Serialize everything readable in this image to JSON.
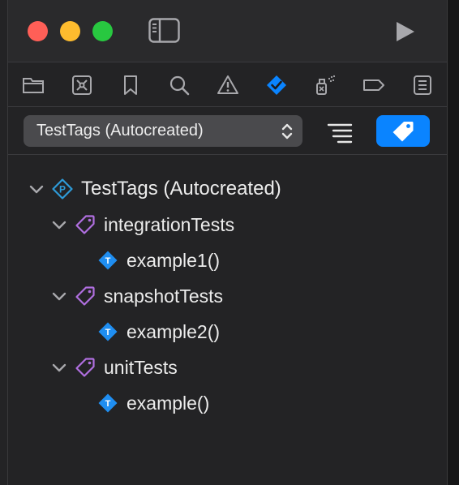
{
  "window": {
    "controls": [
      "close",
      "minimize",
      "zoom"
    ],
    "toolbar_icons": [
      "sidebar-toggle-icon",
      "play-icon"
    ]
  },
  "navigator_tabs": [
    {
      "name": "folder-icon",
      "selected": false
    },
    {
      "name": "source-control-icon",
      "selected": false
    },
    {
      "name": "bookmark-icon",
      "selected": false
    },
    {
      "name": "search-icon",
      "selected": false
    },
    {
      "name": "warning-icon",
      "selected": false
    },
    {
      "name": "test-navigator-icon",
      "selected": true
    },
    {
      "name": "debug-spray-icon",
      "selected": false
    },
    {
      "name": "breakpoint-icon",
      "selected": false
    },
    {
      "name": "report-icon",
      "selected": false
    }
  ],
  "filter": {
    "scheme_label": "TestTags (Autocreated)",
    "list_view": false,
    "tag_view": true
  },
  "tree": {
    "root": {
      "label": "TestTags (Autocreated)",
      "icon": "test-plan-icon",
      "expanded": true
    },
    "tags": [
      {
        "label": "integrationTests",
        "icon": "tag-icon",
        "expanded": true,
        "tests": [
          {
            "label": "example1()",
            "icon": "test-case-icon"
          }
        ]
      },
      {
        "label": "snapshotTests",
        "icon": "tag-icon",
        "expanded": true,
        "tests": [
          {
            "label": "example2()",
            "icon": "test-case-icon"
          }
        ]
      },
      {
        "label": "unitTests",
        "icon": "tag-icon",
        "expanded": true,
        "tests": [
          {
            "label": "example()",
            "icon": "test-case-icon"
          }
        ]
      }
    ]
  },
  "colors": {
    "accent": "#0a84ff",
    "tag_purple": "#b06fe0",
    "test_blue": "#1f8ef1",
    "plan_blue": "#2e9bd8"
  }
}
